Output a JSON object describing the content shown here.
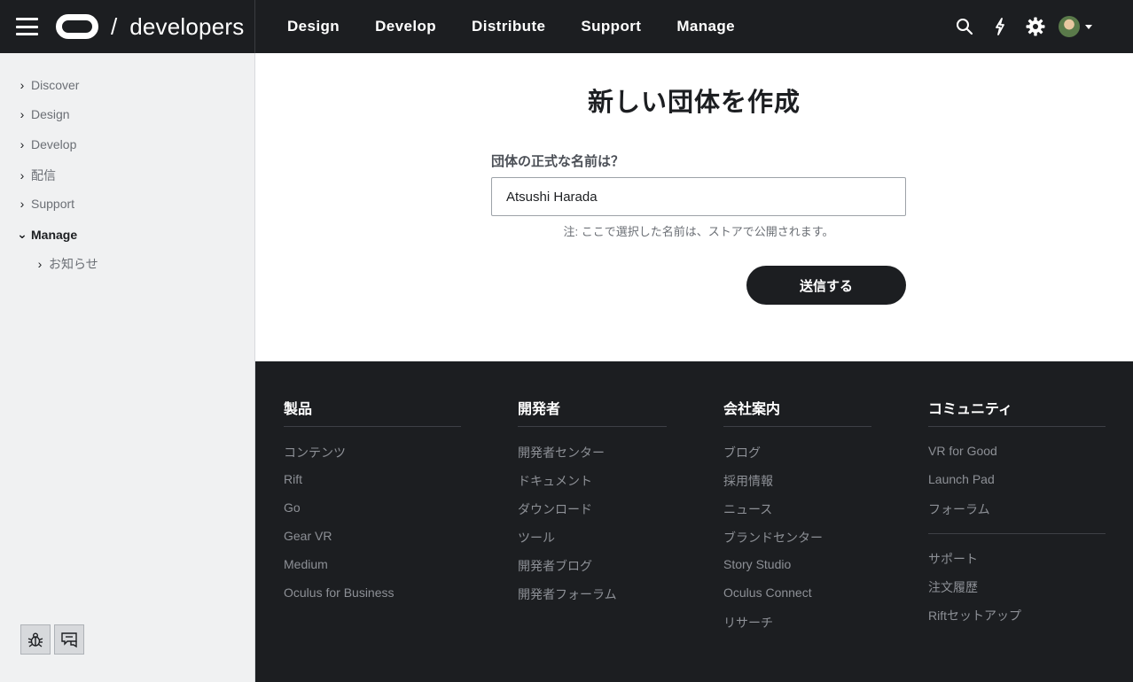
{
  "header": {
    "brand_slash": "/",
    "brand_text": "developers",
    "nav": [
      "Design",
      "Develop",
      "Distribute",
      "Support",
      "Manage"
    ],
    "icons": [
      "search-icon",
      "lightning-icon",
      "gear-icon",
      "avatar",
      "chevron-down-icon"
    ]
  },
  "sidebar": {
    "items": [
      {
        "label": "Discover",
        "expanded": false
      },
      {
        "label": "Design",
        "expanded": false
      },
      {
        "label": "Develop",
        "expanded": false
      },
      {
        "label": "配信",
        "expanded": false
      },
      {
        "label": "Support",
        "expanded": false
      },
      {
        "label": "Manage",
        "expanded": true
      }
    ],
    "subitems": [
      {
        "label": "お知らせ"
      }
    ],
    "tools": [
      "bug-icon",
      "feedback-icon"
    ]
  },
  "main": {
    "title": "新しい団体を作成",
    "field_label": "団体の正式な名前は？",
    "field_value": "Atsushi Harada",
    "note": "注: ここで選択した名前は、ストアで公開されます。",
    "submit_label": "送信する"
  },
  "footer": {
    "columns": [
      {
        "heading": "製品",
        "links": [
          "コンテンツ",
          "Rift",
          "Go",
          "Gear VR",
          "Medium",
          "Oculus for Business"
        ]
      },
      {
        "heading": "開発者",
        "links": [
          "開発者センター",
          "ドキュメント",
          "ダウンロード",
          "ツール",
          "開発者ブログ",
          "開発者フォーラム"
        ]
      },
      {
        "heading": "会社案内",
        "links": [
          "ブログ",
          "採用情報",
          "ニュース",
          "ブランドセンター",
          "Story Studio",
          "Oculus Connect",
          "リサーチ"
        ]
      },
      {
        "heading": "コミュニティ",
        "links": [
          "VR for Good",
          "Launch Pad",
          "フォーラム"
        ],
        "links2": [
          "サポート",
          "注文履歴",
          "Riftセットアップ"
        ]
      }
    ]
  }
}
